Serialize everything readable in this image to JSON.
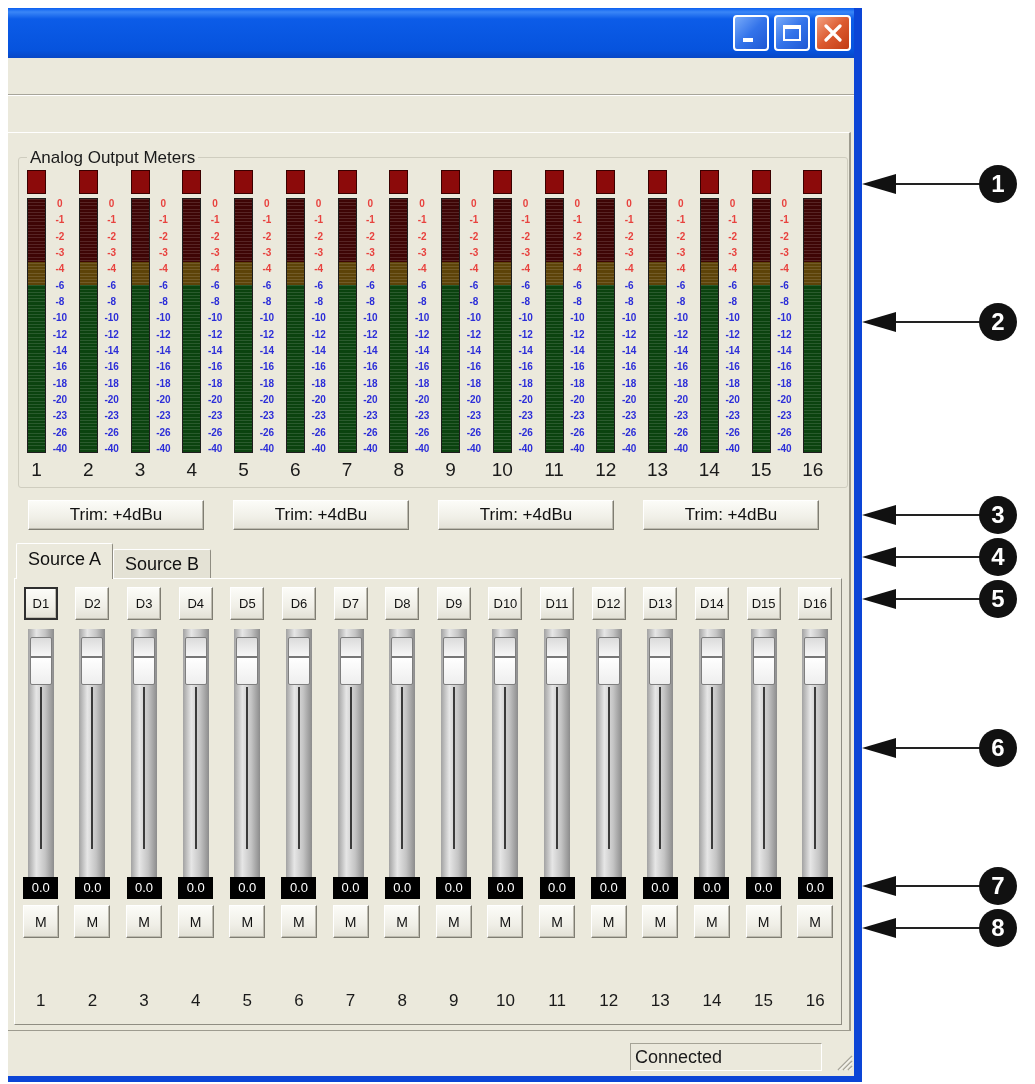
{
  "meter_panel": {
    "title": "Analog Output Meters",
    "meters": [
      {
        "number": "1",
        "scale": {
          "hot": [
            "0",
            "-1",
            "-2",
            "-3",
            "-4"
          ],
          "cold": [
            "-6",
            "-8",
            "-10",
            "-12",
            "-14",
            "-16",
            "-18",
            "-20",
            "-23",
            "-26",
            "-40"
          ]
        }
      },
      {
        "number": "2",
        "scale": {
          "hot": [
            "0",
            "-1",
            "-2",
            "-3",
            "-4"
          ],
          "cold": [
            "-6",
            "-8",
            "-10",
            "-12",
            "-14",
            "-16",
            "-18",
            "-20",
            "-23",
            "-26",
            "-40"
          ]
        }
      },
      {
        "number": "3",
        "scale": {
          "hot": [
            "0",
            "-1",
            "-2",
            "-3",
            "-4"
          ],
          "cold": [
            "-6",
            "-8",
            "-10",
            "-12",
            "-14",
            "-16",
            "-18",
            "-20",
            "-23",
            "-26",
            "-40"
          ]
        }
      },
      {
        "number": "4",
        "scale": {
          "hot": [
            "0",
            "-1",
            "-2",
            "-3",
            "-4"
          ],
          "cold": [
            "-6",
            "-8",
            "-10",
            "-12",
            "-14",
            "-16",
            "-18",
            "-20",
            "-23",
            "-26",
            "-40"
          ]
        }
      },
      {
        "number": "5",
        "scale": {
          "hot": [
            "0",
            "-1",
            "-2",
            "-3",
            "-4"
          ],
          "cold": [
            "-6",
            "-8",
            "-10",
            "-12",
            "-14",
            "-16",
            "-18",
            "-20",
            "-23",
            "-26",
            "-40"
          ]
        }
      },
      {
        "number": "6",
        "scale": {
          "hot": [
            "0",
            "-1",
            "-2",
            "-3",
            "-4"
          ],
          "cold": [
            "-6",
            "-8",
            "-10",
            "-12",
            "-14",
            "-16",
            "-18",
            "-20",
            "-23",
            "-26",
            "-40"
          ]
        }
      },
      {
        "number": "7",
        "scale": {
          "hot": [
            "0",
            "-1",
            "-2",
            "-3",
            "-4"
          ],
          "cold": [
            "-6",
            "-8",
            "-10",
            "-12",
            "-14",
            "-16",
            "-18",
            "-20",
            "-23",
            "-26",
            "-40"
          ]
        }
      },
      {
        "number": "8",
        "scale": {
          "hot": [
            "0",
            "-1",
            "-2",
            "-3",
            "-4"
          ],
          "cold": [
            "-6",
            "-8",
            "-10",
            "-12",
            "-14",
            "-16",
            "-18",
            "-20",
            "-23",
            "-26",
            "-40"
          ]
        }
      },
      {
        "number": "9",
        "scale": {
          "hot": [
            "0",
            "-1",
            "-2",
            "-3",
            "-4"
          ],
          "cold": [
            "-6",
            "-8",
            "-10",
            "-12",
            "-14",
            "-16",
            "-18",
            "-20",
            "-23",
            "-26",
            "-40"
          ]
        }
      },
      {
        "number": "10",
        "scale": {
          "hot": [
            "0",
            "-1",
            "-2",
            "-3",
            "-4"
          ],
          "cold": [
            "-6",
            "-8",
            "-10",
            "-12",
            "-14",
            "-16",
            "-18",
            "-20",
            "-23",
            "-26",
            "-40"
          ]
        }
      },
      {
        "number": "11",
        "scale": {
          "hot": [
            "0",
            "-1",
            "-2",
            "-3",
            "-4"
          ],
          "cold": [
            "-6",
            "-8",
            "-10",
            "-12",
            "-14",
            "-16",
            "-18",
            "-20",
            "-23",
            "-26",
            "-40"
          ]
        }
      },
      {
        "number": "12",
        "scale": {
          "hot": [
            "0",
            "-1",
            "-2",
            "-3",
            "-4"
          ],
          "cold": [
            "-6",
            "-8",
            "-10",
            "-12",
            "-14",
            "-16",
            "-18",
            "-20",
            "-23",
            "-26",
            "-40"
          ]
        }
      },
      {
        "number": "13",
        "scale": {
          "hot": [
            "0",
            "-1",
            "-2",
            "-3",
            "-4"
          ],
          "cold": [
            "-6",
            "-8",
            "-10",
            "-12",
            "-14",
            "-16",
            "-18",
            "-20",
            "-23",
            "-26",
            "-40"
          ]
        }
      },
      {
        "number": "14",
        "scale": {
          "hot": [
            "0",
            "-1",
            "-2",
            "-3",
            "-4"
          ],
          "cold": [
            "-6",
            "-8",
            "-10",
            "-12",
            "-14",
            "-16",
            "-18",
            "-20",
            "-23",
            "-26",
            "-40"
          ]
        }
      },
      {
        "number": "15",
        "scale": {
          "hot": [
            "0",
            "-1",
            "-2",
            "-3",
            "-4"
          ],
          "cold": [
            "-6",
            "-8",
            "-10",
            "-12",
            "-14",
            "-16",
            "-18",
            "-20",
            "-23",
            "-26",
            "-40"
          ]
        }
      },
      {
        "number": "16"
      }
    ]
  },
  "trim_buttons": [
    {
      "label": "Trim: +4dBu"
    },
    {
      "label": "Trim: +4dBu"
    },
    {
      "label": "Trim: +4dBu"
    },
    {
      "label": "Trim: +4dBu"
    }
  ],
  "source_tabs": [
    {
      "label": "Source A",
      "selected": true
    },
    {
      "label": "Source B",
      "selected": false
    }
  ],
  "channels": [
    {
      "source": "D1",
      "selected": true,
      "level": 0.96,
      "readout": "0.0",
      "mute": "M",
      "muted": false,
      "number": "1"
    },
    {
      "source": "D2",
      "selected": false,
      "level": 0.96,
      "readout": "0.0",
      "mute": "M",
      "muted": false,
      "number": "2"
    },
    {
      "source": "D3",
      "selected": false,
      "level": 0.96,
      "readout": "0.0",
      "mute": "M",
      "muted": false,
      "number": "3"
    },
    {
      "source": "D4",
      "selected": false,
      "level": 0.96,
      "readout": "0.0",
      "mute": "M",
      "muted": false,
      "number": "4"
    },
    {
      "source": "D5",
      "selected": false,
      "level": 0.96,
      "readout": "0.0",
      "mute": "M",
      "muted": false,
      "number": "5"
    },
    {
      "source": "D6",
      "selected": false,
      "level": 0.96,
      "readout": "0.0",
      "mute": "M",
      "muted": false,
      "number": "6"
    },
    {
      "source": "D7",
      "selected": false,
      "level": 0.96,
      "readout": "0.0",
      "mute": "M",
      "muted": false,
      "number": "7"
    },
    {
      "source": "D8",
      "selected": false,
      "level": 0.96,
      "readout": "0.0",
      "mute": "M",
      "muted": false,
      "number": "8"
    },
    {
      "source": "D9",
      "selected": false,
      "level": 0.96,
      "readout": "0.0",
      "mute": "M",
      "muted": false,
      "number": "9"
    },
    {
      "source": "D10",
      "selected": false,
      "level": 0.96,
      "readout": "0.0",
      "mute": "M",
      "muted": false,
      "number": "10"
    },
    {
      "source": "D11",
      "selected": false,
      "level": 0.96,
      "readout": "0.0",
      "mute": "M",
      "muted": false,
      "number": "11"
    },
    {
      "source": "D12",
      "selected": false,
      "level": 0.96,
      "readout": "0.0",
      "mute": "M",
      "muted": false,
      "number": "12"
    },
    {
      "source": "D13",
      "selected": false,
      "level": 0.96,
      "readout": "0.0",
      "mute": "M",
      "muted": false,
      "number": "13"
    },
    {
      "source": "D14",
      "selected": false,
      "level": 0.96,
      "readout": "0.0",
      "mute": "M",
      "muted": false,
      "number": "14"
    },
    {
      "source": "D15",
      "selected": false,
      "level": 0.96,
      "readout": "0.0",
      "mute": "M",
      "muted": false,
      "number": "15"
    },
    {
      "source": "D16",
      "selected": false,
      "level": 0.96,
      "readout": "0.0",
      "mute": "M",
      "muted": false,
      "number": "16"
    }
  ],
  "status_bar": {
    "status": "Connected"
  },
  "callouts": [
    "1",
    "2",
    "3",
    "4",
    "5",
    "6",
    "7",
    "8"
  ]
}
